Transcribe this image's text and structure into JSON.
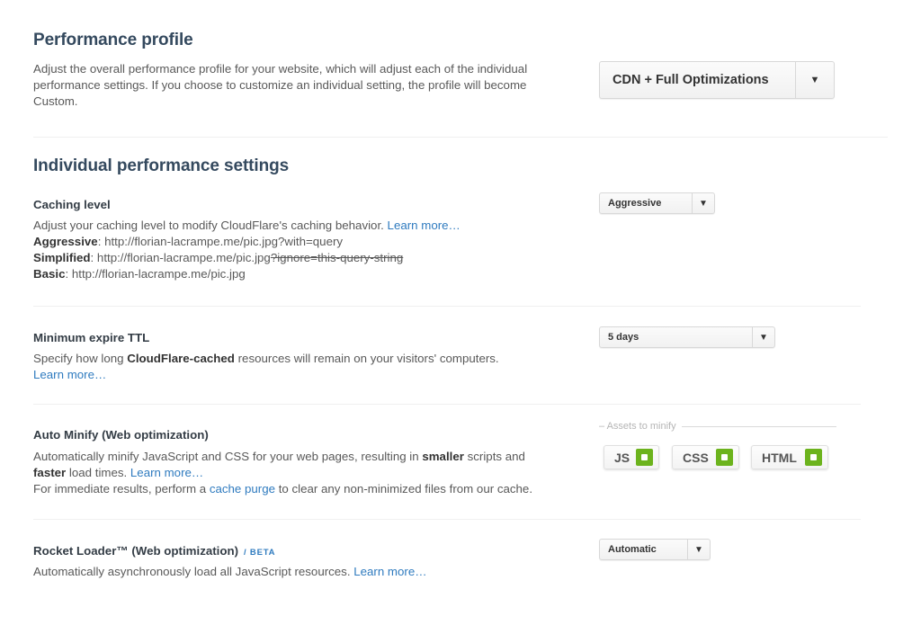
{
  "profile": {
    "title": "Performance profile",
    "description": "Adjust the overall performance profile for your website, which will adjust each of the individual performance settings. If you choose to customize an individual setting, the profile will become Custom.",
    "desc_line1": "Adjust the overall performance profile for your website, which will adjust each of the individual",
    "desc_line2": "performance settings. If you choose to customize an individual setting, the profile will become",
    "desc_line3": "Custom.",
    "selected": "CDN + Full Optimizations",
    "arrow_icon": "▼"
  },
  "individual": {
    "title": "Individual performance settings"
  },
  "caching": {
    "title": "Caching level",
    "description": "Adjust your caching level to modify CloudFlare's caching behavior.",
    "learn_more": "Learn more…",
    "aggressive_label": "Aggressive",
    "aggressive_url": ": http://florian-lacrampe.me/pic.jpg?with=query",
    "simplified_label": "Simplified",
    "simplified_url": ": http://florian-lacrampe.me/pic.jpg",
    "simplified_struck": "?ignore=this-query-string",
    "basic_label": "Basic",
    "basic_url": ": http://florian-lacrampe.me/pic.jpg",
    "selected": "Aggressive",
    "arrow_icon": "▼"
  },
  "ttl": {
    "title": "Minimum expire TTL",
    "desc_pre": "Specify how long ",
    "desc_bold": "CloudFlare-cached",
    "desc_post": " resources will remain on your visitors' computers.",
    "learn_more": "Learn more…",
    "selected": "5 days",
    "arrow_icon": "▼"
  },
  "minify": {
    "title": "Auto Minify (Web optimization)",
    "desc_pre": "Automatically minify JavaScript and CSS for your web pages, resulting in ",
    "desc_bold1": "smaller",
    "desc_mid": " scripts and",
    "desc_bold2": "faster",
    "desc_post": " load times. ",
    "learn_more": "Learn more…",
    "purge_pre": "For immediate results, perform a ",
    "purge_link": "cache purge",
    "purge_post": " to clear any non-minimized files from our cache.",
    "legend": "– Assets to minify",
    "assets": [
      {
        "label": "JS",
        "checked": true
      },
      {
        "label": "CSS",
        "checked": true
      },
      {
        "label": "HTML",
        "checked": true
      }
    ],
    "check_color": "#6cb31d"
  },
  "rocket": {
    "title": "Rocket Loader™ (Web optimization)",
    "badge": "/ BETA",
    "description": "Automatically asynchronously load all JavaScript resources. ",
    "learn_more": "Learn more…",
    "selected": "Automatic",
    "arrow_icon": "▼"
  }
}
